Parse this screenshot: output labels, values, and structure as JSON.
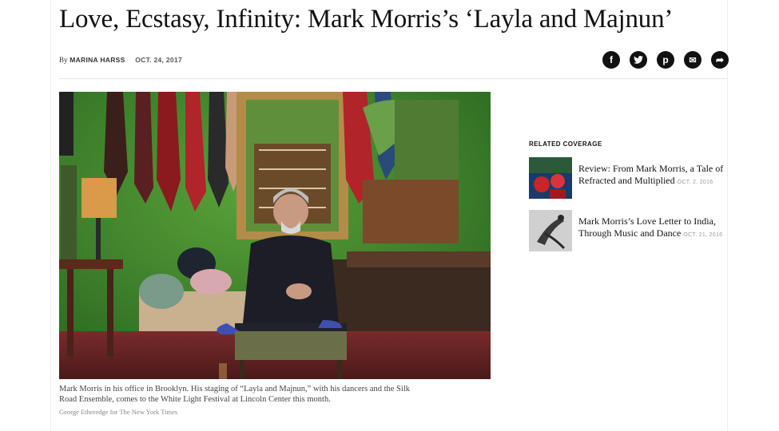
{
  "article": {
    "headline": "Love, Ecstasy, Infinity: Mark Morris’s ‘Layla and Majnun’",
    "byline_prefix": "By",
    "author": "MARINA HARSS",
    "date": "OCT. 24, 2017"
  },
  "share": [
    {
      "icon": "facebook-icon",
      "glyph": "f"
    },
    {
      "icon": "twitter-icon",
      "glyph": "t"
    },
    {
      "icon": "pinterest-icon",
      "glyph": "p"
    },
    {
      "icon": "email-icon",
      "glyph": "✉"
    },
    {
      "icon": "share-arrow-icon",
      "glyph": "➦"
    }
  ],
  "photo": {
    "caption_line1": "Mark Morris in his office in Brooklyn. His staging of “Layla and Majnun,” with his dancers and the Silk",
    "caption_line2": "Road Ensemble, comes to the White Light Festival at Lincoln Center this month.",
    "credit": "George Etheredge for The New York Times"
  },
  "related": {
    "title": "RELATED COVERAGE",
    "items": [
      {
        "line1": "Review: From Mark Morris, a Tale of",
        "line2": "Refracted and Multiplied",
        "date": "OCT. 2, 2016"
      },
      {
        "line1": "Mark Morris’s Love Letter to India,",
        "line2": "Through Music and Dance",
        "date": "OCT. 21, 2016"
      }
    ]
  },
  "colors": {
    "wall_green": "#3b7d2a",
    "text": "#121212",
    "icon_bg": "#111111"
  }
}
